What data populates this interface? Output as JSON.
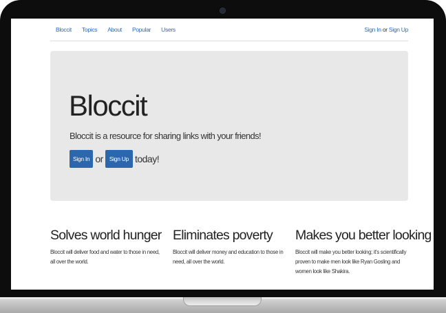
{
  "nav": {
    "links": [
      "Bloccit",
      "Topics",
      "About",
      "Popular",
      "Users"
    ],
    "sign_in": "Sign In",
    "or": "or",
    "sign_up": "Sign Up"
  },
  "hero": {
    "title": "Bloccit",
    "lead": "Bloccit is a resource for sharing links with your friends!",
    "sign_in_button": "Sign In",
    "or": "or",
    "sign_up_button": "Sign Up",
    "tail": "today!"
  },
  "features": [
    {
      "title": "Solves world hunger",
      "text": "Bloccit will deliver food and water to those in need, all over the world."
    },
    {
      "title": "Eliminates poverty",
      "text": "Bloccit will deliver money and education to those in need, all over the world."
    },
    {
      "title": "Makes you better looking",
      "text": "Bloccit will make you better looking; it's scientifically proven to make men look like Ryan Gosling and women look like Shakira."
    }
  ],
  "colors": {
    "link": "#2a6ac0",
    "button": "#2c67ad",
    "jumbotron_bg": "#e8e8e8",
    "bezel": "#0d0d0d"
  }
}
